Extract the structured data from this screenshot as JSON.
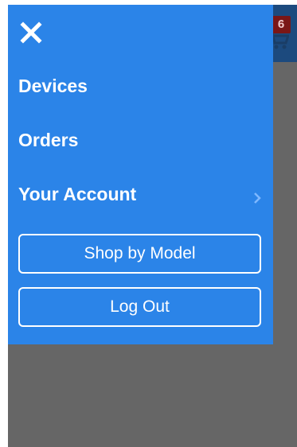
{
  "header": {
    "cart_count": "6"
  },
  "menu": {
    "items": [
      {
        "label": "Devices"
      },
      {
        "label": "Orders"
      },
      {
        "label": "Your Account",
        "has_submenu": true
      }
    ],
    "shop_by_model_label": "Shop by Model",
    "logout_label": "Log Out"
  },
  "icons": {
    "close": "close-icon",
    "chevron": "chevron-right-icon",
    "cart": "shopping-cart-icon"
  },
  "colors": {
    "drawer_bg": "#2b84e8",
    "overlay": "#666666",
    "header_bg": "#1c4a7e",
    "badge_bg": "#7a1616",
    "chevron": "#7fb8ff"
  }
}
